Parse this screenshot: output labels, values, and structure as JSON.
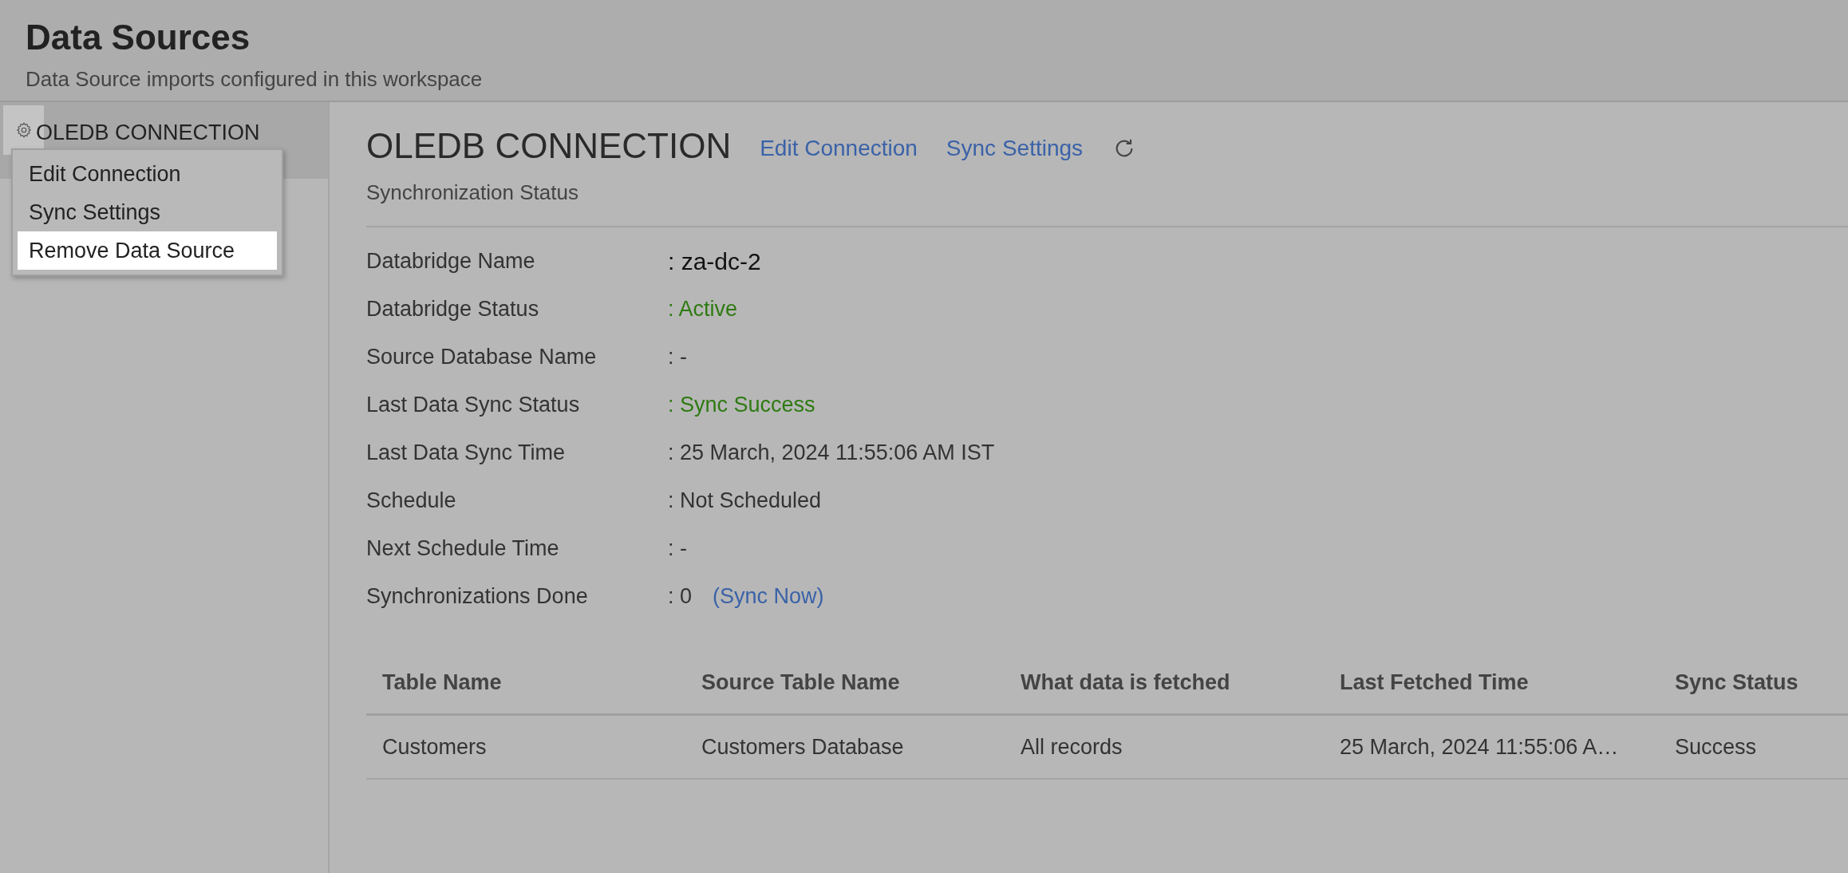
{
  "header": {
    "title": "Data Sources",
    "subtitle": "Data Source imports configured in this workspace"
  },
  "sidebar": {
    "items": [
      {
        "label": "OLEDB CONNECTION",
        "selected": true
      }
    ]
  },
  "context_menu": {
    "items": [
      {
        "label": "Edit Connection",
        "selected": false
      },
      {
        "label": "Sync Settings",
        "selected": false
      },
      {
        "label": "Remove Data Source",
        "selected": true
      }
    ]
  },
  "detail": {
    "title": "OLEDB CONNECTION",
    "links": [
      "Edit Connection",
      "Sync Settings"
    ],
    "section": "Synchronization Status",
    "rows": [
      {
        "label": "Databridge Name",
        "value": ": za-dc-2",
        "kind": "emphasis"
      },
      {
        "label": "Databridge Status",
        "value": ": Active",
        "kind": "success"
      },
      {
        "label": "Source Database Name",
        "value": ": -",
        "kind": "plain"
      },
      {
        "label": "Last Data Sync Status",
        "value": ": Sync Success",
        "kind": "success"
      },
      {
        "label": "Last Data Sync Time",
        "value": ": 25 March, 2024 11:55:06 AM IST",
        "kind": "plain"
      },
      {
        "label": "Schedule",
        "value": ": Not Scheduled",
        "kind": "plain"
      },
      {
        "label": "Next Schedule Time",
        "value": ": -",
        "kind": "plain"
      },
      {
        "label": "Synchronizations Done",
        "value": ": 0",
        "kind": "plain",
        "link": "(Sync Now)"
      }
    ]
  },
  "table": {
    "columns": [
      "Table Name",
      "Source Table Name",
      "What data is fetched",
      "Last Fetched Time",
      "Sync Status"
    ],
    "rows": [
      [
        "Customers",
        "Customers Database",
        "All records",
        "25 March, 2024 11:55:06 A…",
        "Success"
      ]
    ]
  }
}
